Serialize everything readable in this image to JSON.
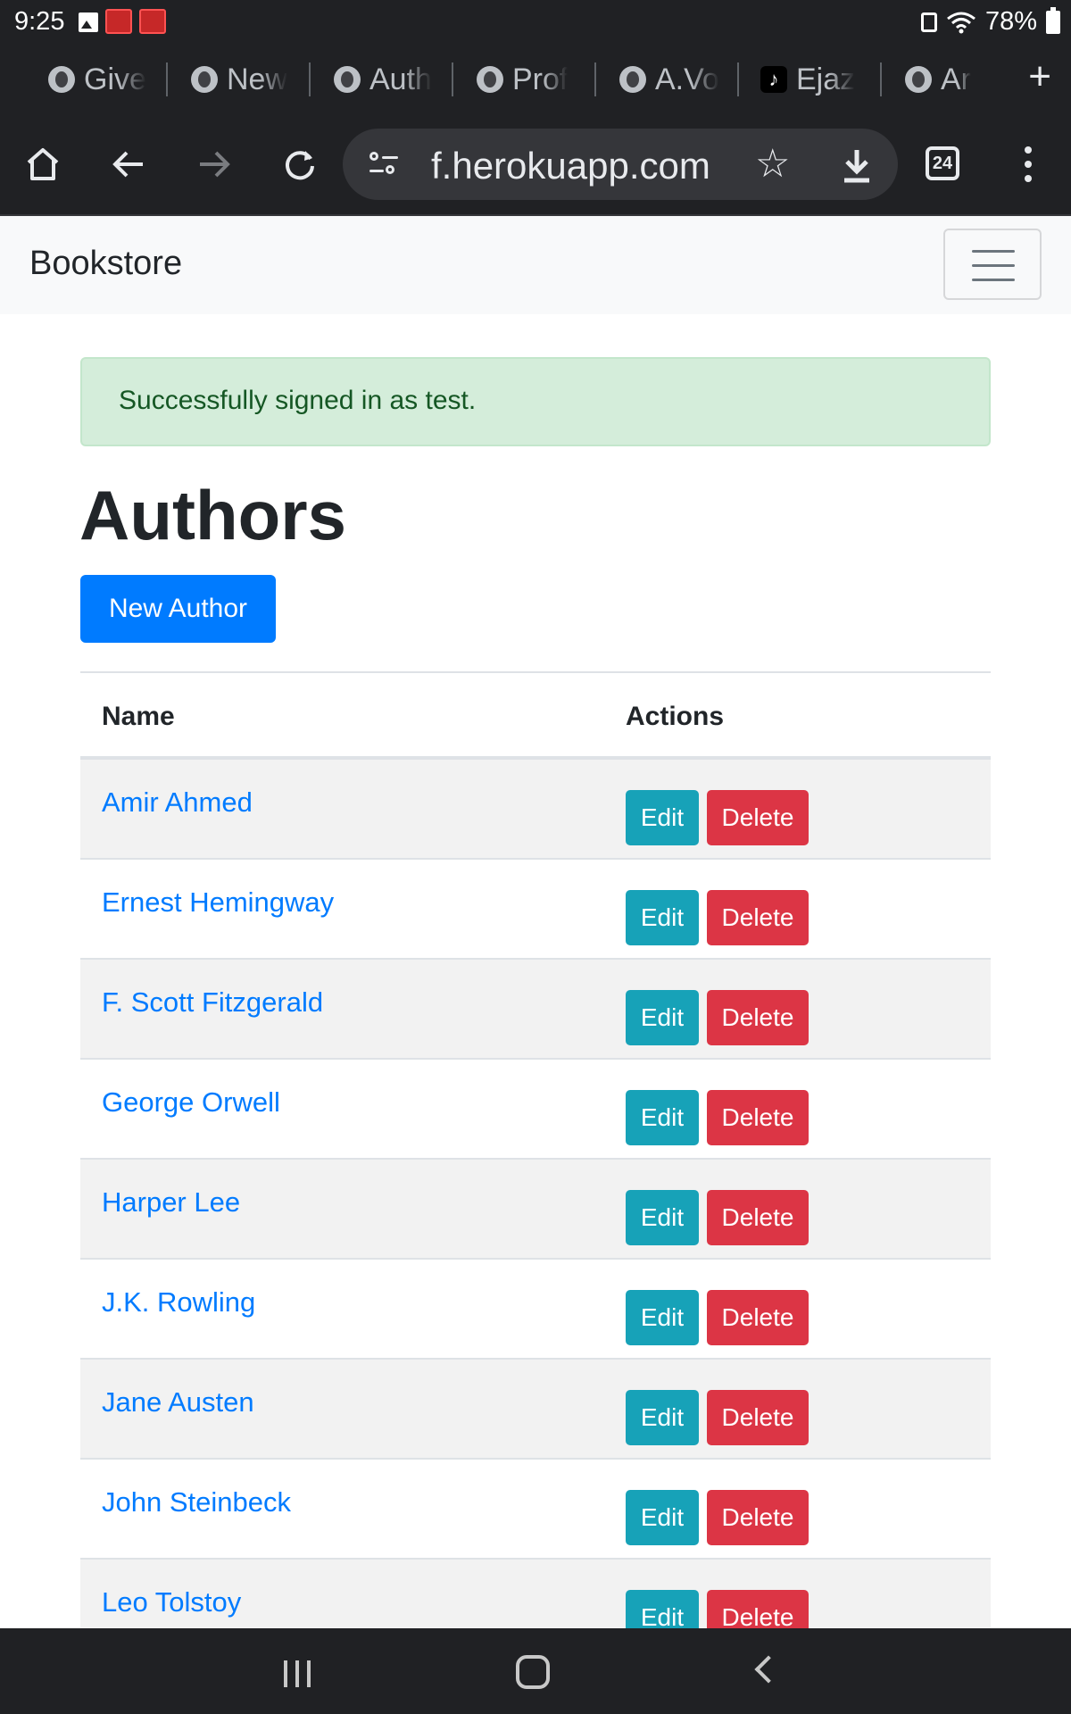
{
  "status_bar": {
    "time": "9:25",
    "battery": "78%",
    "icons": [
      "gallery-icon",
      "app-notification-icon",
      "app-notification-icon",
      "lock-icon",
      "wifi-icon",
      "battery-icon"
    ]
  },
  "browser": {
    "tabs": [
      {
        "label": "Give",
        "icon": "globe-icon"
      },
      {
        "label": "New",
        "icon": "chrome-icon"
      },
      {
        "label": "Auth",
        "icon": "globe-icon"
      },
      {
        "label": "Prof",
        "icon": "globe-icon"
      },
      {
        "label": "A.Vo",
        "icon": "globe-icon"
      },
      {
        "label": "Ejaz",
        "icon": "tiktok-icon"
      },
      {
        "label": "Ar",
        "icon": "globe-icon"
      }
    ],
    "new_tab_glyph": "+",
    "url": "f.herokuapp.com",
    "tab_count": "24"
  },
  "navbar": {
    "brand": "Bookstore"
  },
  "alert": {
    "message": "Successfully signed in as test."
  },
  "page": {
    "title": "Authors",
    "new_button": "New Author"
  },
  "table": {
    "headers": [
      "Name",
      "Actions"
    ],
    "edit_label": "Edit",
    "delete_label": "Delete",
    "rows": [
      "Amir Ahmed",
      "Ernest Hemingway",
      "F. Scott Fitzgerald",
      "George Orwell",
      "Harper Lee",
      "J.K. Rowling",
      "Jane Austen",
      "John Steinbeck",
      "Leo Tolstoy"
    ]
  },
  "colors": {
    "primary": "#007bff",
    "info": "#17a2b8",
    "danger": "#dc3545",
    "success_bg": "#d4edda",
    "success_text": "#155724"
  }
}
